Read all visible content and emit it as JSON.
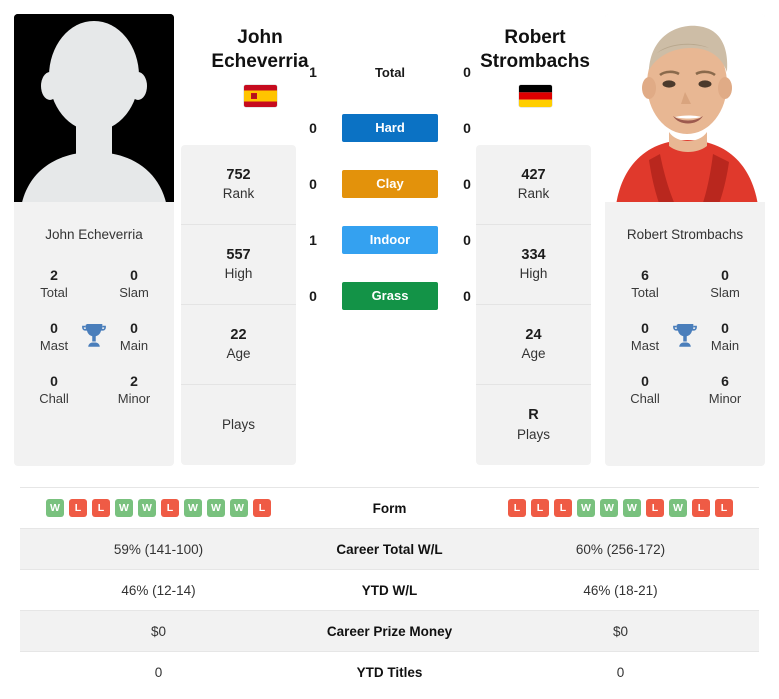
{
  "players": {
    "left": {
      "first_name": "John",
      "last_name": "Echeverria",
      "full_name": "John Echeverria",
      "flag": "spain-flag",
      "photo": "silhouette-placeholder-photo",
      "rank": "752",
      "rank_label": "Rank",
      "high": "557",
      "high_label": "High",
      "age": "22",
      "age_label": "Age",
      "plays": "",
      "plays_label": "Plays",
      "titles": {
        "total": "2",
        "total_label": "Total",
        "slam": "0",
        "slam_label": "Slam",
        "mast": "0",
        "mast_label": "Mast",
        "main": "0",
        "main_label": "Main",
        "chall": "0",
        "chall_label": "Chall",
        "minor": "2",
        "minor_label": "Minor"
      }
    },
    "right": {
      "first_name": "Robert",
      "last_name": "Strombachs",
      "full_name": "Robert Strombachs",
      "flag": "germany-flag",
      "photo": "player-portrait-photo",
      "rank": "427",
      "rank_label": "Rank",
      "high": "334",
      "high_label": "High",
      "age": "24",
      "age_label": "Age",
      "plays": "R",
      "plays_label": "Plays",
      "titles": {
        "total": "6",
        "total_label": "Total",
        "slam": "0",
        "slam_label": "Slam",
        "mast": "0",
        "mast_label": "Mast",
        "main": "0",
        "main_label": "Main",
        "chall": "0",
        "chall_label": "Chall",
        "minor": "6",
        "minor_label": "Minor"
      }
    }
  },
  "head_to_head": [
    {
      "label": "Total",
      "left": "1",
      "right": "0",
      "styled": false,
      "color": ""
    },
    {
      "label": "Hard",
      "left": "0",
      "right": "0",
      "styled": true,
      "color": "#0b72c4"
    },
    {
      "label": "Clay",
      "left": "0",
      "right": "0",
      "styled": true,
      "color": "#e3920b"
    },
    {
      "label": "Indoor",
      "left": "1",
      "right": "0",
      "styled": true,
      "color": "#34a1f0"
    },
    {
      "label": "Grass",
      "left": "0",
      "right": "0",
      "styled": true,
      "color": "#139347"
    }
  ],
  "comparison_rows": [
    {
      "label": "Form",
      "type": "form",
      "left_form": [
        "W",
        "L",
        "L",
        "W",
        "W",
        "L",
        "W",
        "W",
        "W",
        "L"
      ],
      "right_form": [
        "L",
        "L",
        "L",
        "W",
        "W",
        "W",
        "L",
        "W",
        "L",
        "L"
      ]
    },
    {
      "label": "Career Total W/L",
      "type": "text",
      "left": "59% (141-100)",
      "right": "60% (256-172)"
    },
    {
      "label": "YTD W/L",
      "type": "text",
      "left": "46% (12-14)",
      "right": "46% (18-21)"
    },
    {
      "label": "Career Prize Money",
      "type": "text",
      "left": "$0",
      "right": "$0"
    },
    {
      "label": "YTD Titles",
      "type": "text",
      "left": "0",
      "right": "0"
    }
  ],
  "colors": {
    "win": "#79c17e",
    "loss": "#ef5b45",
    "trophy": "#4a7ebb",
    "card_bg": "#f2f2f2"
  },
  "icons": {
    "trophy": "trophy-icon"
  }
}
